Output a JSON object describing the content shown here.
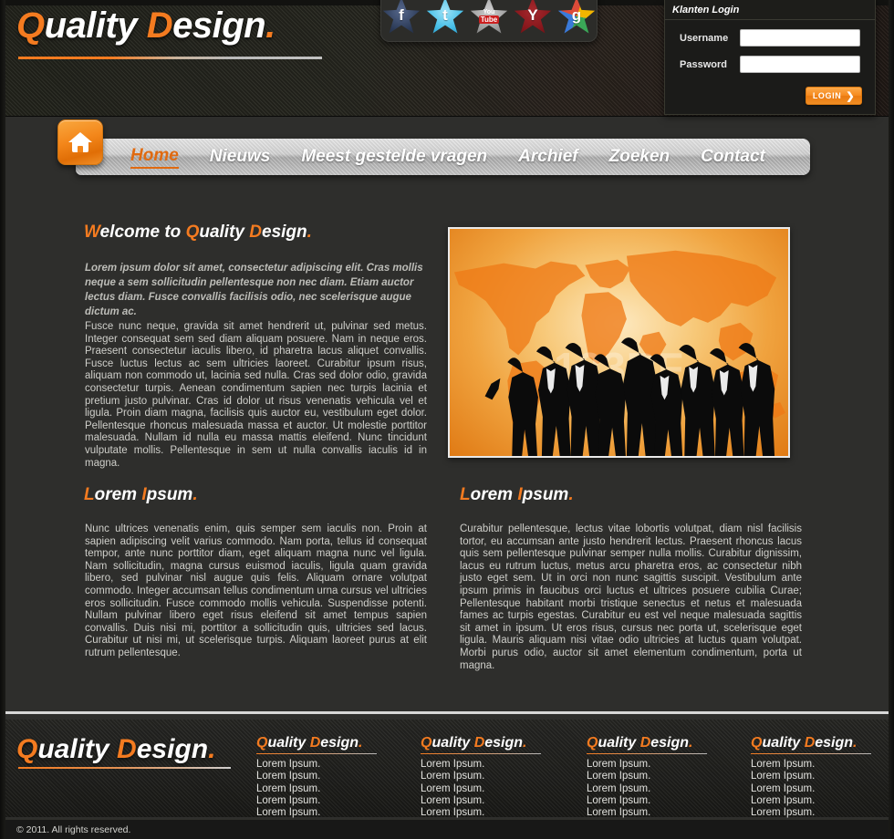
{
  "brand": {
    "name_part1": "Q",
    "name_part2": "uality ",
    "name_part3": "D",
    "name_part4": "esign",
    "name_dot": ".",
    "accent_color": "#f47b20"
  },
  "social": {
    "items": [
      {
        "name": "facebook",
        "glyph": "f",
        "label": "Facebook"
      },
      {
        "name": "twitter",
        "glyph": "t",
        "label": "Twitter"
      },
      {
        "name": "youtube",
        "glyph_top": "You",
        "glyph_bottom": "Tube",
        "label": "YouTube"
      },
      {
        "name": "yahoo",
        "glyph": "Y",
        "label": "Yahoo"
      },
      {
        "name": "googleplus",
        "glyph": "g",
        "label": "Google Plus"
      }
    ]
  },
  "login": {
    "title": "Klanten Login",
    "username_label": "Username",
    "username_value": "",
    "username_placeholder": "",
    "password_label": "Password",
    "password_value": "",
    "password_placeholder": "",
    "button_label": "LOGIN",
    "button_chevron": "❯"
  },
  "nav": {
    "home_icon": "home-icon",
    "items": [
      {
        "label": "Home",
        "active": true
      },
      {
        "label": "Nieuws",
        "active": false
      },
      {
        "label": "Meest gestelde vragen",
        "active": false
      },
      {
        "label": "Archief",
        "active": false
      },
      {
        "label": "Zoeken",
        "active": false
      },
      {
        "label": "Contact",
        "active": false
      }
    ]
  },
  "main": {
    "welcome_heading": {
      "p1": "W",
      "p2": "elcome to ",
      "p3": "Q",
      "p4": "uality ",
      "p5": "D",
      "p6": "esign",
      "p7": "."
    },
    "intro": "Lorem ipsum dolor sit amet, consectetur adipiscing elit. Cras mollis neque a sem sollicitudin pellentesque non nec diam. Etiam auctor lectus diam. Fusce convallis facilisis odio, nec scelerisque augue dictum ac.",
    "body_left_1": "Fusce nunc neque, gravida sit amet hendrerit ut, pulvinar sed metus. Integer consequat sem sed diam aliquam posuere. Nam in neque eros. Praesent consectetur iaculis libero, id pharetra lacus aliquet convallis. Fusce luctus lectus ac sem ultricies laoreet. Curabitur ipsum risus, aliquam non commodo ut, lacinia sed nulla. Cras sed dolor odio, gravida consectetur turpis. Aenean condimentum sapien nec turpis lacinia et pretium justo pulvinar. Cras id dolor ut risus venenatis vehicula vel et ligula. Proin diam magna, facilisis quis auctor eu, vestibulum eget dolor. Pellentesque rhoncus malesuada massa et auctor. Ut molestie porttitor malesuada. Nullam id nulla eu massa mattis eleifend. Nunc tincidunt vulputate mollis. Pellentesque in sem ut nulla convallis iaculis id in magna.",
    "subheading_left": {
      "p1": "L",
      "p2": "orem ",
      "p3": "I",
      "p4": "psum",
      "p5": "."
    },
    "subheading_right": {
      "p1": "L",
      "p2": "orem ",
      "p3": "I",
      "p4": "psum",
      "p5": "."
    },
    "body_left_2": "Nunc ultrices venenatis enim, quis semper sem iaculis non. Proin at sapien adipiscing velit varius commodo. Nam porta, tellus id consequat tempor, ante nunc porttitor diam, eget aliquam magna nunc vel ligula. Nam sollicitudin, magna cursus euismod iaculis, ligula quam gravida libero, sed pulvinar nisl augue quis felis. Aliquam ornare volutpat commodo. Integer accumsan tellus condimentum urna cursus vel ultricies eros sollicitudin. Fusce commodo mollis vehicula. Suspendisse potenti. Nullam pulvinar libero eget risus eleifend sit amet tempus sapien convallis. Duis nisi mi, porttitor a sollicitudin quis, ultricies sed lacus. Curabitur ut nisi mi, ut scelerisque turpis. Aliquam laoreet purus at elit rutrum pellentesque.",
    "body_right_2": "Curabitur pellentesque, lectus vitae lobortis volutpat, diam nisl facilisis tortor, eu accumsan ante justo hendrerit lectus. Praesent rhoncus lacus quis sem pellentesque pulvinar semper nulla mollis. Curabitur dignissim, lacus eu rutrum luctus, metus arcu pharetra eros, ac consectetur nibh justo eget sem. Ut in orci non nunc sagittis suscipit. Vestibulum ante ipsum primis in faucibus orci luctus et ultrices posuere cubilia Curae; Pellentesque habitant morbi tristique senectus et netus et malesuada fames ac turpis egestas. Curabitur eu est vel neque malesuada sagittis sit amet in ipsum. Ut eros risus, cursus nec porta ut, scelerisque eget ligula. Mauris aliquam nisi vitae odio ultricies at luctus quam volutpat. Morbi purus odio, auctor sit amet elementum condimentum, porta ut magna.",
    "hero_image": {
      "name": "business-team-world-map",
      "watermark": "123RF"
    }
  },
  "footer": {
    "logo": {
      "p1": "Q",
      "p2": "uality ",
      "p3": "D",
      "p4": "esign",
      "p5": "."
    },
    "columns": [
      {
        "title": {
          "p1": "Q",
          "p2": "uality ",
          "p3": "D",
          "p4": "esign",
          "p5": "."
        },
        "links": [
          "Lorem Ipsum.",
          "Lorem Ipsum.",
          "Lorem Ipsum.",
          "Lorem Ipsum.",
          "Lorem Ipsum."
        ]
      },
      {
        "title": {
          "p1": "Q",
          "p2": "uality ",
          "p3": "D",
          "p4": "esign",
          "p5": "."
        },
        "links": [
          "Lorem Ipsum.",
          "Lorem Ipsum.",
          "Lorem Ipsum.",
          "Lorem Ipsum.",
          "Lorem Ipsum."
        ]
      },
      {
        "title": {
          "p1": "Q",
          "p2": "uality ",
          "p3": "D",
          "p4": "esign",
          "p5": "."
        },
        "links": [
          "Lorem Ipsum.",
          "Lorem Ipsum.",
          "Lorem Ipsum.",
          "Lorem Ipsum.",
          "Lorem Ipsum."
        ]
      },
      {
        "title": {
          "p1": "Q",
          "p2": "uality ",
          "p3": "D",
          "p4": "esign",
          "p5": "."
        },
        "links": [
          "Lorem Ipsum.",
          "Lorem Ipsum.",
          "Lorem Ipsum.",
          "Lorem Ipsum.",
          "Lorem Ipsum."
        ]
      }
    ],
    "copyright": "© 2011.  All rights reserved."
  }
}
